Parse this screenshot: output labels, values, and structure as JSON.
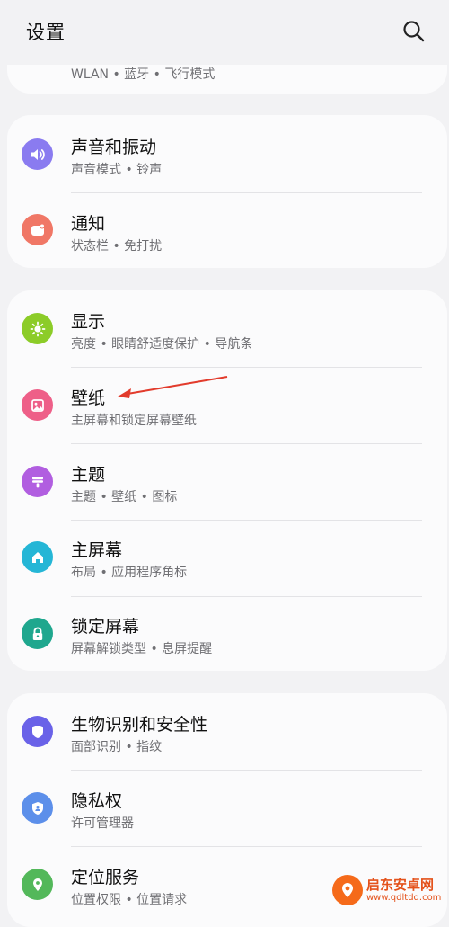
{
  "header": {
    "title": "设置"
  },
  "top_partial": {
    "subtitle": "WLAN • 蓝牙 • 飞行模式"
  },
  "groups": [
    {
      "items": [
        {
          "title": "声音和振动",
          "subtitle": "声音模式 • 铃声",
          "icon": "speaker-icon",
          "color": "#8a7bf0"
        },
        {
          "title": "通知",
          "subtitle": "状态栏 • 免打扰",
          "icon": "notification-icon",
          "color": "#f07766"
        }
      ]
    },
    {
      "items": [
        {
          "title": "显示",
          "subtitle": "亮度 • 眼睛舒适度保护 • 导航条",
          "icon": "brightness-icon",
          "color": "#8ccc28"
        },
        {
          "title": "壁纸",
          "subtitle": "主屏幕和锁定屏幕壁纸",
          "icon": "wallpaper-icon",
          "color": "#ee5f88"
        },
        {
          "title": "主题",
          "subtitle": "主题 • 壁纸 • 图标",
          "icon": "theme-brush-icon",
          "color": "#b15ee0"
        },
        {
          "title": "主屏幕",
          "subtitle": "布局 • 应用程序角标",
          "icon": "home-icon",
          "color": "#25b6d6"
        },
        {
          "title": "锁定屏幕",
          "subtitle": "屏幕解锁类型 • 息屏提醒",
          "icon": "lock-icon",
          "color": "#1fa78e"
        }
      ]
    },
    {
      "items": [
        {
          "title": "生物识别和安全性",
          "subtitle": "面部识别 • 指纹",
          "icon": "shield-icon",
          "color": "#6a62e8"
        },
        {
          "title": "隐私权",
          "subtitle": "许可管理器",
          "icon": "privacy-shield-icon",
          "color": "#5c8fea"
        },
        {
          "title": "定位服务",
          "subtitle": "位置权限 • 位置请求",
          "icon": "location-pin-icon",
          "color": "#53b85a"
        }
      ]
    }
  ],
  "annotation": {
    "arrow_color": "#e23b2c"
  },
  "watermark": {
    "name": "启东安卓网",
    "url": "www.qdltdq.com"
  }
}
